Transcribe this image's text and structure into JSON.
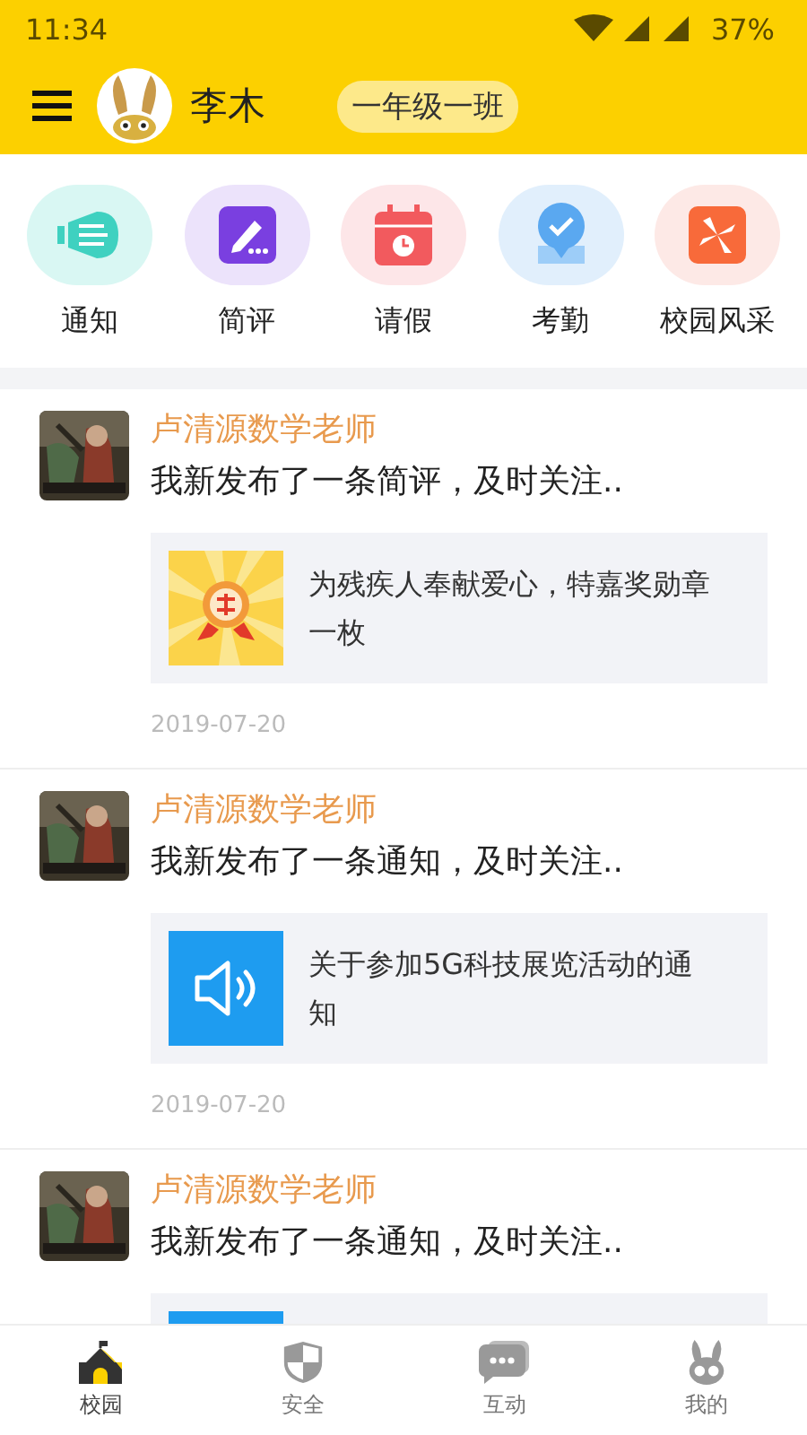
{
  "status_bar": {
    "time": "11:34",
    "battery": "37%"
  },
  "header": {
    "user_name": "李木",
    "class_badge": "一年级一班"
  },
  "quick_menu": [
    {
      "kind": "notice",
      "label": "通知"
    },
    {
      "kind": "review",
      "label": "简评"
    },
    {
      "kind": "leave",
      "label": "请假"
    },
    {
      "kind": "attendance",
      "label": "考勤"
    },
    {
      "kind": "gallery",
      "label": "校园风采"
    }
  ],
  "posts": [
    {
      "author": "卢清源数学老师",
      "message": "我新发布了一条简评，及时关注..",
      "attachment": {
        "kind": "award",
        "text": "为残疾人奉献爱心，特嘉奖勋章一枚"
      },
      "date": "2019-07-20"
    },
    {
      "author": "卢清源数学老师",
      "message": "我新发布了一条通知，及时关注..",
      "attachment": {
        "kind": "notice",
        "text": "关于参加5G科技展览活动的通知"
      },
      "date": "2019-07-20"
    },
    {
      "author": "卢清源数学老师",
      "message": "我新发布了一条通知，及时关注..",
      "attachment": {
        "kind": "notice"
      }
    }
  ],
  "tab_bar": [
    {
      "kind": "campus",
      "label": "校园",
      "selected": true
    },
    {
      "kind": "safety",
      "label": "安全",
      "selected": false
    },
    {
      "kind": "chat",
      "label": "互动",
      "selected": false
    },
    {
      "kind": "me",
      "label": "我的",
      "selected": false
    }
  ]
}
